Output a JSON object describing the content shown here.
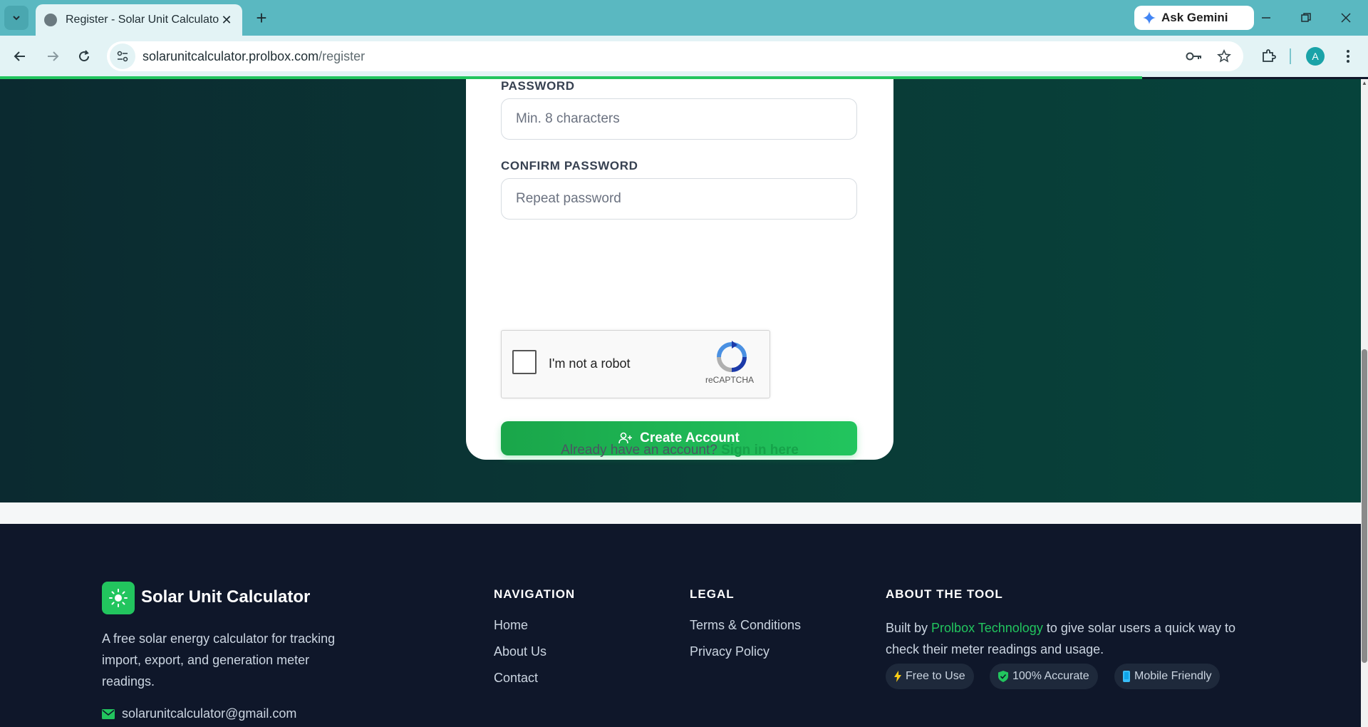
{
  "browser": {
    "tab_title": "Register - Solar Unit Calculator",
    "gemini_label": "Ask Gemini",
    "url_host": "solarunitcalculator.prolbox.com",
    "url_path": "/register",
    "avatar_letter": "A"
  },
  "form": {
    "password_label": "PASSWORD",
    "password_placeholder": "Min. 8 characters",
    "confirm_label": "CONFIRM PASSWORD",
    "confirm_placeholder": "Repeat password",
    "captcha_text": "I'm not a robot",
    "captcha_brand": "reCAPTCHA",
    "submit_label": "Create Account",
    "signin_prompt": "Already have an account?",
    "signin_link": "Sign in here"
  },
  "footer": {
    "brand_name": "Solar Unit Calculator",
    "brand_desc": "A free solar energy calculator for tracking import, export, and generation meter readings.",
    "email": "solarunitcalculator@gmail.com",
    "navigation": {
      "heading": "NAVIGATION",
      "links": [
        "Home",
        "About Us",
        "Contact"
      ]
    },
    "legal": {
      "heading": "LEGAL",
      "links": [
        "Terms & Conditions",
        "Privacy Policy"
      ]
    },
    "about": {
      "heading": "ABOUT THE TOOL",
      "text_before": "Built by",
      "link": "Prolbox Technology",
      "text_after": "to give solar users a quick way to check their meter readings and usage.",
      "badges": [
        "Free to Use",
        "100% Accurate",
        "Mobile Friendly"
      ]
    }
  },
  "colors": {
    "accent": "#22c55e",
    "footer_bg": "#0f172a",
    "hero_bg": "#0a3a36",
    "chrome": "#5ab8c1"
  }
}
